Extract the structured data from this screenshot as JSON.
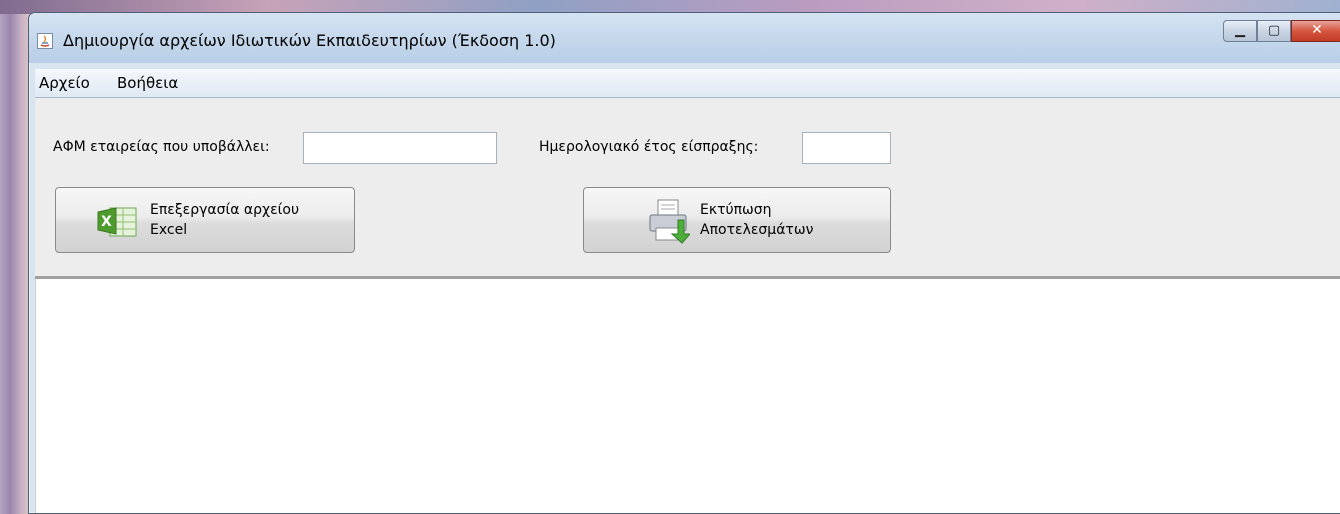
{
  "window": {
    "title": "Δημιουργία αρχείων Ιδιωτικών Εκπαιδευτηρίων (Έκδοση 1.0)"
  },
  "menu": {
    "file": "Αρχείο",
    "help": "Βοήθεια"
  },
  "form": {
    "afm_label": "ΑΦΜ εταιρείας που υποβάλλει:",
    "afm_value": "",
    "year_label": "Ημερολογιακό έτος είσπραξης:",
    "year_value": ""
  },
  "buttons": {
    "process_excel": "Επεξεργασία αρχείου\nExcel",
    "print_results": "Εκτύπωση\nΑποτελεσμάτων"
  },
  "output": {
    "text": ""
  },
  "colors": {
    "accent_green": "#4f9a2e",
    "close_red": "#d5563f"
  }
}
